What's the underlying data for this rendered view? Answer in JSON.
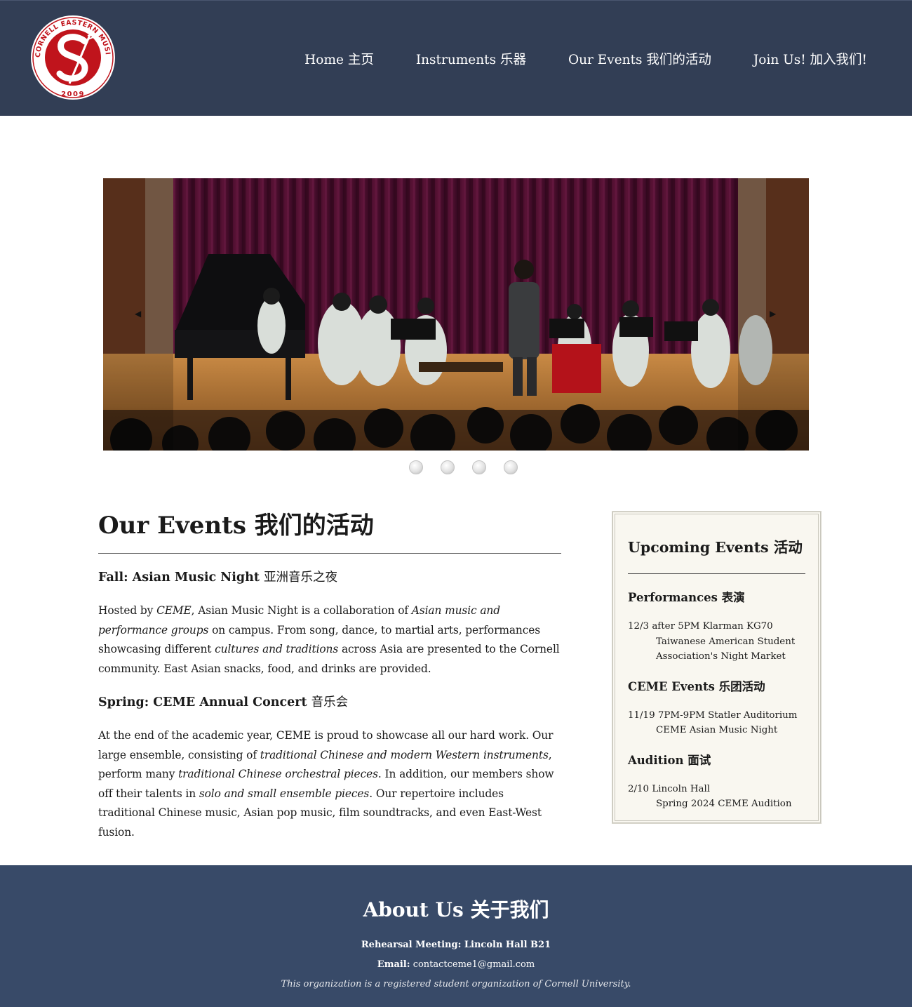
{
  "logo": {
    "ring_text": "CORNELL EASTERN MUSIC ENSEMBLE",
    "year": "2009",
    "colors": {
      "red": "#c0141c",
      "white": "#ffffff"
    }
  },
  "nav": {
    "items": [
      {
        "label": "Home 主页"
      },
      {
        "label": "Instruments 乐器"
      },
      {
        "label": "Our Events 我们的活动"
      },
      {
        "label": "Join Us! 加入我们!"
      }
    ]
  },
  "carousel": {
    "prev_icon": "◀",
    "next_icon": "▶",
    "slide_count": 4,
    "active_slide": 1
  },
  "main": {
    "title": "Our Events 我们的活动",
    "sections": [
      {
        "heading": "Fall: Asian Music Night",
        "heading_cn": "亚洲音乐之夜",
        "parts": [
          {
            "t": "Hosted by "
          },
          {
            "t": "CEME",
            "i": true
          },
          {
            "t": ", Asian Music Night is a collaboration of "
          },
          {
            "t": "Asian music and performance groups",
            "i": true
          },
          {
            "t": " on campus. From song, dance, to martial arts, performances showcasing different "
          },
          {
            "t": "cultures and traditions",
            "i": true
          },
          {
            "t": " across Asia are presented to the Cornell community. East Asian snacks, food, and drinks are provided."
          }
        ]
      },
      {
        "heading": "Spring: CEME Annual Concert",
        "heading_cn": "音乐会",
        "parts": [
          {
            "t": "At the end of the academic year, CEME is proud to showcase all our hard work. Our large ensemble, consisting of "
          },
          {
            "t": "traditional Chinese and modern Western instruments",
            "i": true
          },
          {
            "t": ", perform many "
          },
          {
            "t": "traditional Chinese orchestral pieces",
            "i": true
          },
          {
            "t": ". In addition, our members show off their talents in "
          },
          {
            "t": "solo and small ensemble pieces",
            "i": true
          },
          {
            "t": ". Our repertoire includes traditional Chinese music, Asian pop music, film soundtracks, and even East-West fusion."
          }
        ]
      }
    ]
  },
  "sidebar": {
    "title": "Upcoming Events 活动",
    "groups": [
      {
        "heading": "Performances 表演",
        "events": [
          {
            "when": "12/3 after 5PM Klarman KG70",
            "what": "Taiwanese American Student Association's Night Market"
          }
        ]
      },
      {
        "heading": "CEME Events 乐团活动",
        "events": [
          {
            "when": "11/19 7PM-9PM Statler Auditorium",
            "what": "CEME Asian Music Night"
          }
        ]
      },
      {
        "heading": "Audition 面试",
        "events": [
          {
            "when": "2/10 Lincoln Hall",
            "what": "Spring 2024 CEME Audition"
          }
        ]
      }
    ]
  },
  "footer": {
    "title": "About Us 关于我们",
    "rehearsal": "Rehearsal Meeting: Lincoln Hall B21",
    "email_label": "Email:",
    "email": "contactceme1@gmail.com",
    "note": "This organization is a registered student organization of Cornell University."
  },
  "colors": {
    "header_bg": "#323e55",
    "footer_bg": "#384a68",
    "sidebar_bg": "#f9f7f0",
    "logo_red": "#c0141c"
  }
}
